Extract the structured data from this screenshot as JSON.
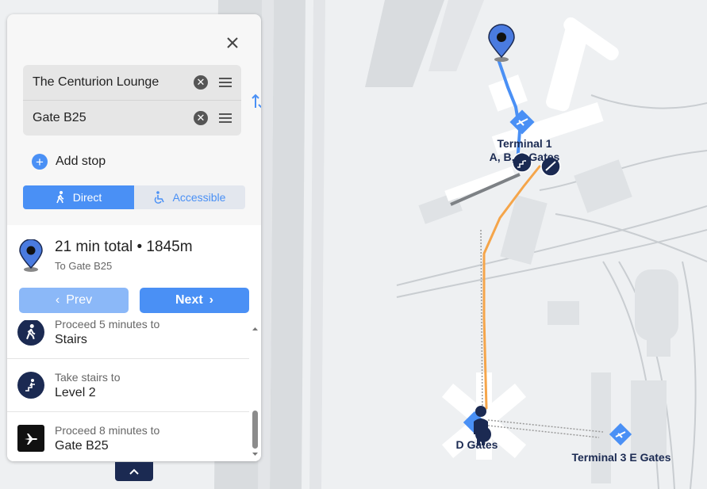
{
  "map": {
    "labels": {
      "terminal1_line1": "Terminal 1",
      "terminal1_line2": "A, B, C Gates",
      "d_gates": "D Gates",
      "terminal3": "Terminal 3 E Gates"
    }
  },
  "directions": {
    "origin": "The Centurion Lounge",
    "destination": "Gate B25",
    "add_stop_label": "Add stop",
    "modes": [
      {
        "label": "Direct",
        "icon": "walk-icon",
        "active": true
      },
      {
        "label": "Accessible",
        "icon": "wheelchair-icon",
        "active": false
      }
    ]
  },
  "summary": {
    "title": "21 min total • 1845m",
    "subtitle": "To Gate B25",
    "prev_label": "Prev",
    "next_label": "Next"
  },
  "steps": [
    {
      "action": "Proceed 5 minutes to",
      "target": "Stairs",
      "icon": "walk-icon"
    },
    {
      "action": "Take stairs to",
      "target": "Level 2",
      "icon": "stairs-icon"
    },
    {
      "action": "Proceed 8 minutes to",
      "target": "Gate B25",
      "icon": "airplane-icon"
    }
  ],
  "colors": {
    "accent": "#4a90f5",
    "navy": "#1b2a52",
    "route_orange": "#f5a54a",
    "route_blue": "#4a90f5"
  }
}
